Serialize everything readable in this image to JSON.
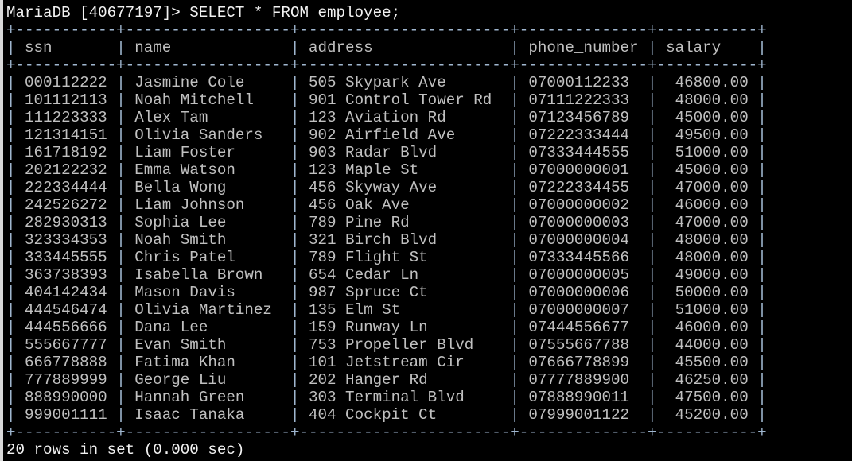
{
  "terminal": {
    "prompt": "MariaDB [40677197]> SELECT * FROM employee;",
    "footer": "20 rows in set (0.000 sec)",
    "colors": {
      "background": "#000000",
      "text": "#c0c0c0",
      "border": "#9fb6cf"
    }
  },
  "table": {
    "columns": [
      "ssn",
      "name",
      "address",
      "phone_number",
      "salary"
    ],
    "rows": [
      [
        "000112222",
        "Jasmine Cole",
        "505 Skypark Ave",
        "07000112233",
        "46800.00"
      ],
      [
        "101112113",
        "Noah Mitchell",
        "901 Control Tower Rd",
        "07111222333",
        "48000.00"
      ],
      [
        "111223333",
        "Alex Tam",
        "123 Aviation Rd",
        "07123456789",
        "45000.00"
      ],
      [
        "121314151",
        "Olivia Sanders",
        "902 Airfield Ave",
        "07222333444",
        "49500.00"
      ],
      [
        "161718192",
        "Liam Foster",
        "903 Radar Blvd",
        "07333444555",
        "51000.00"
      ],
      [
        "202122232",
        "Emma Watson",
        "123 Maple St",
        "07000000001",
        "45000.00"
      ],
      [
        "222334444",
        "Bella Wong",
        "456 Skyway Ave",
        "07222334455",
        "47000.00"
      ],
      [
        "242526272",
        "Liam Johnson",
        "456 Oak Ave",
        "07000000002",
        "46000.00"
      ],
      [
        "282930313",
        "Sophia Lee",
        "789 Pine Rd",
        "07000000003",
        "47000.00"
      ],
      [
        "323334353",
        "Noah Smith",
        "321 Birch Blvd",
        "07000000004",
        "48000.00"
      ],
      [
        "333445555",
        "Chris Patel",
        "789 Flight St",
        "07333445566",
        "48000.00"
      ],
      [
        "363738393",
        "Isabella Brown",
        "654 Cedar Ln",
        "07000000005",
        "49000.00"
      ],
      [
        "404142434",
        "Mason Davis",
        "987 Spruce Ct",
        "07000000006",
        "50000.00"
      ],
      [
        "444546474",
        "Olivia Martinez",
        "135 Elm St",
        "07000000007",
        "51000.00"
      ],
      [
        "444556666",
        "Dana Lee",
        "159 Runway Ln",
        "07444556677",
        "46000.00"
      ],
      [
        "555667777",
        "Evan Smith",
        "753 Propeller Blvd",
        "07555667788",
        "44000.00"
      ],
      [
        "666778888",
        "Fatima Khan",
        "101 Jetstream Cir",
        "07666778899",
        "45500.00"
      ],
      [
        "777889999",
        "George Liu",
        "202 Hanger Rd",
        "07777889900",
        "46250.00"
      ],
      [
        "888990000",
        "Hannah Green",
        "303 Terminal Blvd",
        "07888990011",
        "47500.00"
      ],
      [
        "999001111",
        "Isaac Tanaka",
        "404 Cockpit Ct",
        "07999001122",
        "45200.00"
      ]
    ]
  }
}
